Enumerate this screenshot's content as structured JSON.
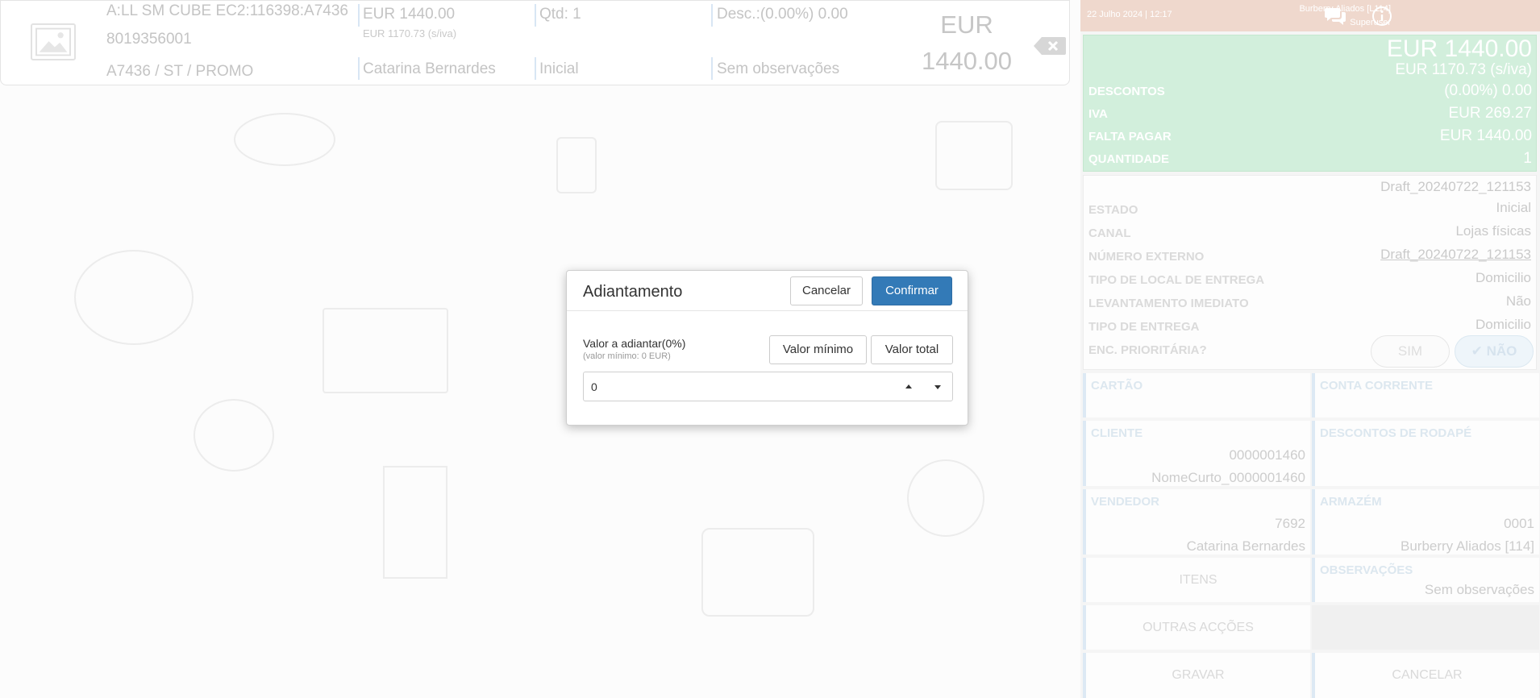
{
  "item": {
    "description": "A:LL SM CUBE EC2:116398:A7436",
    "code": "8019356001",
    "reference": "A7436 / ST / PROMO",
    "price": "EUR 1440.00",
    "price_no_vat": "EUR 1170.73 (s/iva)",
    "quantity": "Qtd: 1",
    "discount": "Desc.:(0.00%) 0.00",
    "seller": "Catarina Bernardes",
    "state": "Inicial",
    "notes": "Sem observações",
    "total_currency": "EUR",
    "total_amount": "1440.00"
  },
  "topbar": {
    "datetime": "22 Julho 2024 | 12:17",
    "store": "Burberry Aliados [L114]",
    "role": "Superuser",
    "icons": [
      "chat-icon",
      "info-icon"
    ]
  },
  "totals": {
    "total": "EUR 1440.00",
    "total_no_vat": "EUR 1170.73 (s/iva)",
    "rows": [
      {
        "label": "DESCONTOS",
        "value": "(0.00%) 0.00"
      },
      {
        "label": "IVA",
        "value": "EUR 269.27"
      },
      {
        "label": "FALTA PAGAR",
        "value": "EUR 1440.00"
      },
      {
        "label": "QUANTIDADE",
        "value": "1"
      }
    ]
  },
  "order_info": {
    "draft_id": "Draft_20240722_121153",
    "rows": [
      {
        "label": "ESTADO",
        "value": "Inicial"
      },
      {
        "label": "CANAL",
        "value": "Lojas físicas"
      },
      {
        "label": "NÚMERO EXTERNO",
        "value": "Draft_20240722_121153"
      },
      {
        "label": "TIPO DE LOCAL DE ENTREGA",
        "value": "Domicilio"
      },
      {
        "label": "LEVANTAMENTO IMEDIATO",
        "value": "Não"
      },
      {
        "label": "TIPO DE ENTREGA",
        "value": "Domicilio"
      },
      {
        "label": "ENC. PRIORITÁRIA?",
        "value": ""
      }
    ],
    "priority_yes": "SIM",
    "priority_no": "NÃO"
  },
  "tiles": {
    "cartao": "CARTÃO",
    "conta_corrente": "CONTA CORRENTE",
    "cliente_label": "CLIENTE",
    "cliente_id": "0000001460",
    "cliente_name": "NomeCurto_0000001460",
    "descontos_rodape": "DESCONTOS DE RODAPÉ",
    "vendedor_label": "VENDEDOR",
    "vendedor_id": "7692",
    "vendedor_name": "Catarina Bernardes",
    "armazem_label": "ARMAZÉM",
    "armazem_id": "0001",
    "armazem_name": "Burberry Aliados [114]",
    "itens": "ITENS",
    "observacoes_label": "OBSERVAÇÕES",
    "observacoes_value": "Sem observações",
    "outras_accoes": "OUTRAS ACÇÕES",
    "gravar": "GRAVAR",
    "cancelar": "CANCELAR"
  },
  "modal": {
    "title": "Adiantamento",
    "cancel_label": "Cancelar",
    "confirm_label": "Confirmar",
    "field_label": "Valor a adiantar(0%)",
    "field_hint": "(valor mínimo: 0 EUR)",
    "min_value_label": "Valor mínimo",
    "total_value_label": "Valor total",
    "input_value": "0"
  },
  "colors": {
    "primary": "#337ab7",
    "topbar": "#efd8cd",
    "totals_bg": "#d2efdc"
  }
}
